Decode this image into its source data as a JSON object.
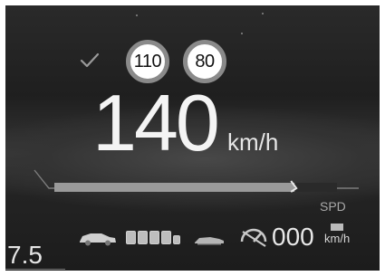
{
  "hud": {
    "speed_limit_signs": [
      "110",
      "80"
    ],
    "current_speed": "140",
    "speed_unit": "km/h",
    "speed_bar_fill_fraction": 0.85,
    "spd_label": "SPD",
    "cruise": {
      "set_speed": "000",
      "unit": "km/h"
    },
    "odometer_partial": "7.5",
    "following_distance_bars": 5,
    "icons": [
      "check-icon",
      "lead-car-icon",
      "own-car-icon",
      "cruise-control-icon",
      "unit-indicator-icon"
    ]
  }
}
